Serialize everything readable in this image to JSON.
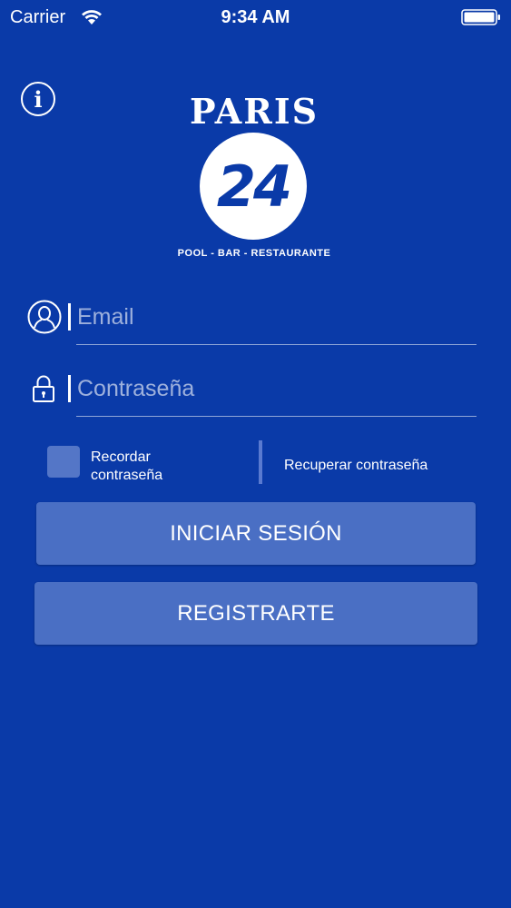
{
  "status_bar": {
    "carrier": "Carrier",
    "time": "9:34 AM",
    "wifi_icon": "wifi-icon",
    "battery_icon": "battery-icon"
  },
  "info_button": {
    "icon": "info-icon",
    "glyph": "i"
  },
  "logo": {
    "name": "PARIS",
    "number": "24",
    "tagline": "POOL - BAR - RESTAURANTE"
  },
  "email_field": {
    "icon": "user-icon",
    "placeholder": "Email",
    "value": ""
  },
  "password_field": {
    "icon": "lock-icon",
    "placeholder": "Contraseña",
    "value": ""
  },
  "remember": {
    "label": "Recordar contraseña",
    "checked": false
  },
  "recover_link": "Recuperar contraseña",
  "buttons": {
    "login": "INICIAR SESIÓN",
    "register": "REGISTRARTE"
  },
  "colors": {
    "background": "#0a3aa8",
    "button": "#4a6fc4",
    "checkbox": "#5476c7"
  }
}
